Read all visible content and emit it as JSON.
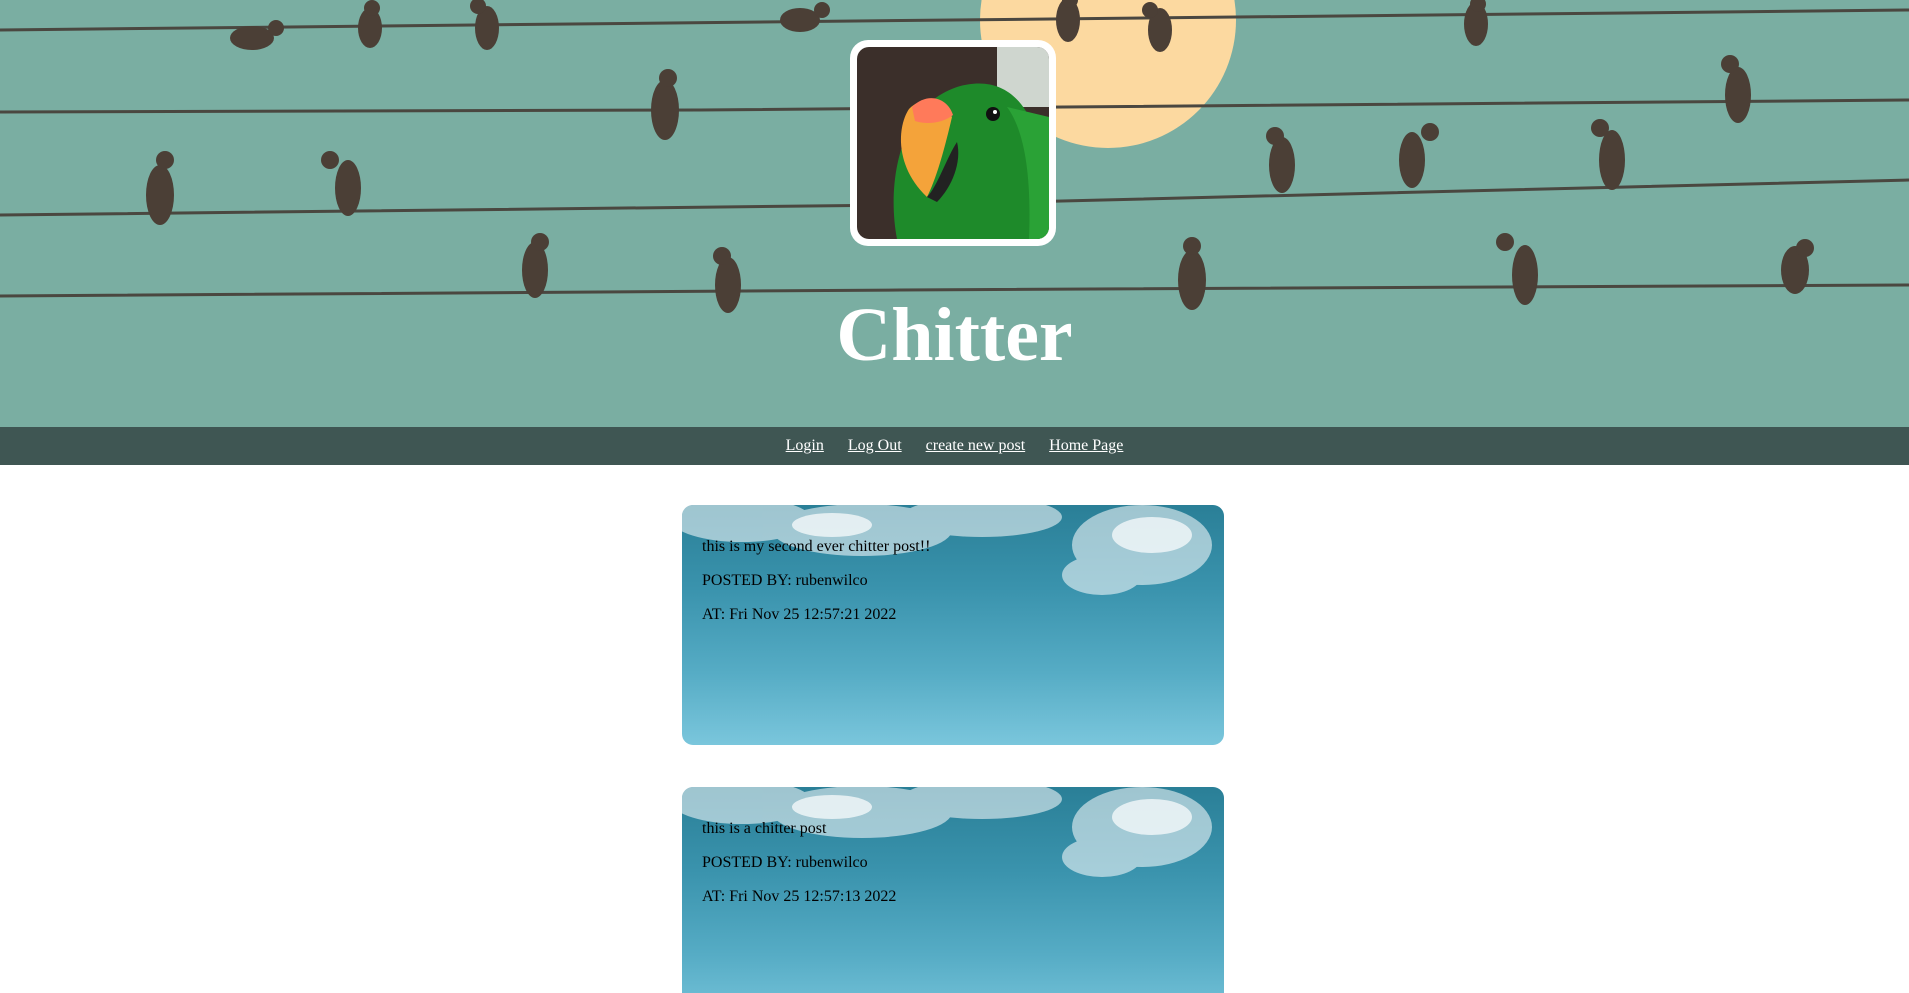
{
  "site": {
    "title": "Chitter",
    "avatar_icon": "parrot-avatar",
    "banner_icon": "birds-on-wires-banner"
  },
  "nav": {
    "items": [
      {
        "label": "Login"
      },
      {
        "label": "Log Out"
      },
      {
        "label": "create new post"
      },
      {
        "label": "Home Page"
      }
    ]
  },
  "posts": [
    {
      "text": "this is my second ever chitter post!!",
      "posted_by": "POSTED BY: rubenwilco",
      "at": "AT: Fri Nov 25 12:57:21 2022"
    },
    {
      "text": "this is a chitter post",
      "posted_by": "POSTED BY: rubenwilco",
      "at": "AT: Fri Nov 25 12:57:13 2022"
    }
  ],
  "colors": {
    "banner_bg": "#7aaea2",
    "nav_bg": "#3f5653",
    "moon": "#fcd9a0",
    "bird": "#4b3f36",
    "post_gradient_top": "#2a7f97",
    "post_gradient_bottom": "#7ac6dc"
  }
}
